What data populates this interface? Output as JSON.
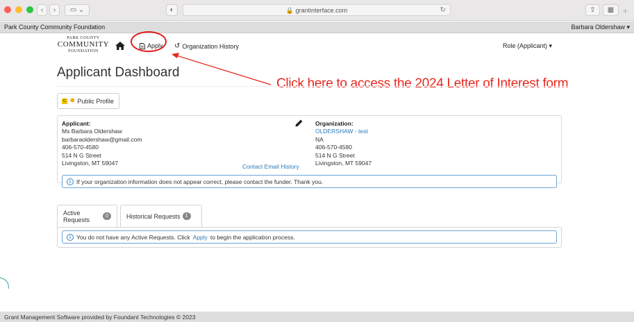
{
  "browser": {
    "url": "grantinterface.com",
    "colors": {
      "close": "#fe5f57",
      "minimize": "#febc2e",
      "zoom": "#28c840"
    }
  },
  "topbar": {
    "brand": "Park County Community Foundation",
    "user": "Barbara Oldershaw ▾"
  },
  "nav": {
    "logo_line1": "PARK COUNTY",
    "logo_line2": "COMMUNITY",
    "logo_line3": "FOUNDATION",
    "apply": "Apply",
    "org_history": "Organization History",
    "role": "Role (Applicant) ▾"
  },
  "callout": {
    "text": "Click here to access the 2024 Letter of Interest form",
    "color": "#e8271d"
  },
  "page": {
    "title": "Applicant Dashboard",
    "public_profile": "Public Profile"
  },
  "applicant": {
    "heading": "Applicant:",
    "name": "Ms Barbara Oldershaw",
    "email": "barbaraoldershaw@gmail.com",
    "phone": "406-570-4580",
    "street": "514 N G Street",
    "city": "Livingston, MT 59047",
    "contact_history": "Contact Email History"
  },
  "organization": {
    "heading": "Organization:",
    "name": "OLDERSHAW - test",
    "line1": "NA",
    "phone": "406-570-4580",
    "street": "514 N G Street",
    "city": "Livingston, MT 59047"
  },
  "alerts": {
    "org_info": "If your organization information does not appear correct, please contact the funder. Thank you.",
    "no_requests_pre": "You do not have any Active Requests. Click",
    "no_requests_link": "Apply",
    "no_requests_post": "to begin the application process."
  },
  "tabs": {
    "active_label": "Active Requests",
    "active_count": "0",
    "historical_label": "Historical Requests",
    "historical_count": "1"
  },
  "footer": {
    "text": "Grant Management Software provided by Foundant Technologies © 2023"
  }
}
